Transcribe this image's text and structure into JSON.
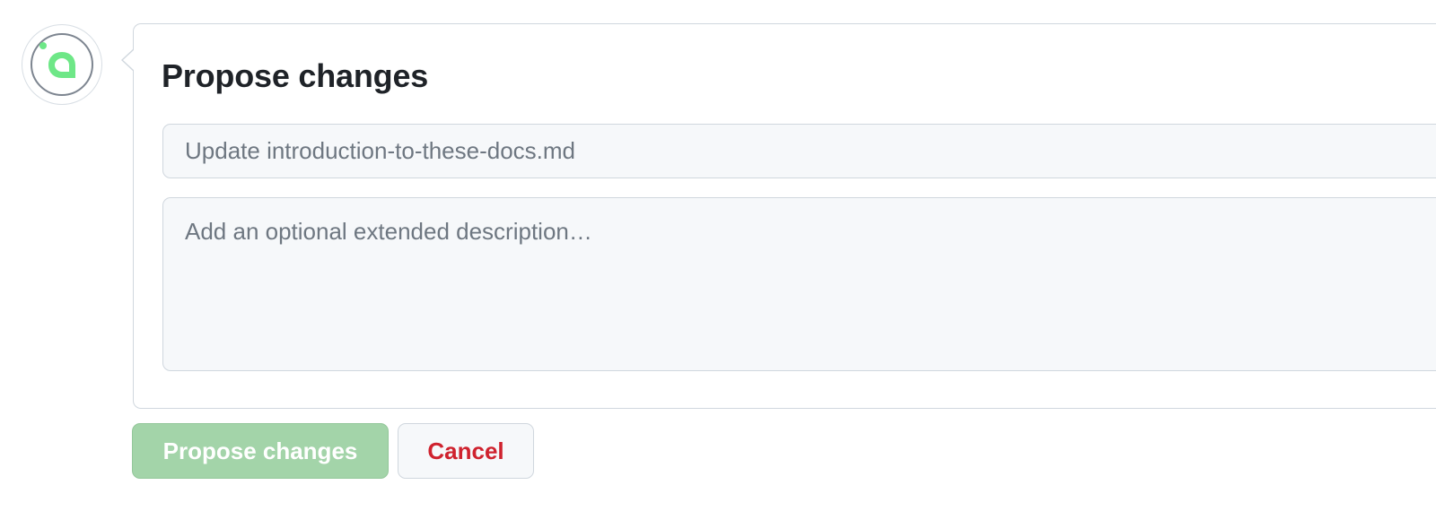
{
  "avatar": {
    "icon": "bot-logo-icon",
    "ring_color": "#7d8590",
    "accent_color": "#6ee787"
  },
  "form": {
    "title": "Propose changes",
    "summary": {
      "value": "",
      "placeholder": "Update introduction-to-these-docs.md"
    },
    "description": {
      "value": "",
      "placeholder": "Add an optional extended description…"
    }
  },
  "actions": {
    "propose_label": "Propose changes",
    "cancel_label": "Cancel"
  },
  "colors": {
    "primary_disabled": "#a3d4a9",
    "danger_text": "#cf222e",
    "border": "#d0d7de",
    "input_bg": "#f6f8fa"
  }
}
